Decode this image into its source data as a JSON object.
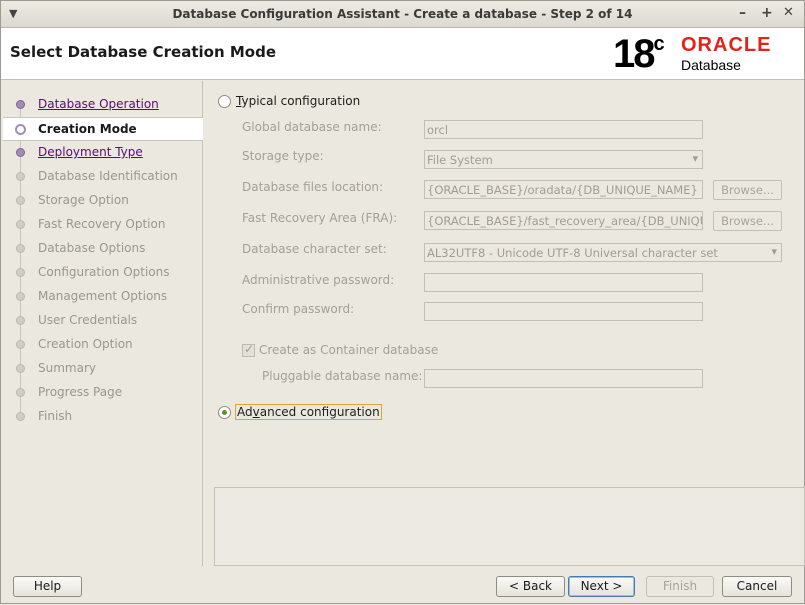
{
  "window": {
    "title": "Database Configuration Assistant - Create a database - Step 2 of 14",
    "controls": [
      "–",
      "+",
      "✕"
    ]
  },
  "header": {
    "page_title": "Select Database Creation Mode",
    "logo": {
      "version": "18",
      "version_sup": "c",
      "brand": "ORACLE",
      "product": "Database",
      "brand_color": "#e2231a"
    }
  },
  "sidebar": {
    "steps": [
      {
        "label": "Database Operation",
        "state": "done"
      },
      {
        "label": "Creation Mode",
        "state": "current"
      },
      {
        "label": "Deployment Type",
        "state": "done"
      },
      {
        "label": "Database Identification",
        "state": "pending"
      },
      {
        "label": "Storage Option",
        "state": "pending"
      },
      {
        "label": "Fast Recovery Option",
        "state": "pending"
      },
      {
        "label": "Database Options",
        "state": "pending"
      },
      {
        "label": "Configuration Options",
        "state": "pending"
      },
      {
        "label": "Management Options",
        "state": "pending"
      },
      {
        "label": "User Credentials",
        "state": "pending"
      },
      {
        "label": "Creation Option",
        "state": "pending"
      },
      {
        "label": "Summary",
        "state": "pending"
      },
      {
        "label": "Progress Page",
        "state": "pending"
      },
      {
        "label": "Finish",
        "state": "pending"
      }
    ]
  },
  "main": {
    "typical": {
      "label_mnemonic": "T",
      "label_rest": "ypical configuration",
      "selected": false,
      "global_db_name": {
        "label": "Global database name:",
        "value": "orcl"
      },
      "storage_type": {
        "label": "Storage type:",
        "value": "File System"
      },
      "db_files_location": {
        "label": "Database files location:",
        "value": "{ORACLE_BASE}/oradata/{DB_UNIQUE_NAME}",
        "browse": "Browse..."
      },
      "fra": {
        "label": "Fast Recovery Area (FRA):",
        "value": "{ORACLE_BASE}/fast_recovery_area/{DB_UNIQUE_NAME}",
        "browse": "Browse..."
      },
      "charset": {
        "label": "Database character set:",
        "value": "AL32UTF8 - Unicode UTF-8 Universal character set"
      },
      "admin_password": {
        "label": "Administrative password:",
        "value": ""
      },
      "confirm_password": {
        "label": "Confirm password:",
        "value": ""
      },
      "container_db": {
        "label": "Create as Container database",
        "checked": true
      },
      "pdb_name": {
        "label": "Pluggable database name:",
        "value": ""
      }
    },
    "advanced": {
      "label_pre": "Ad",
      "label_mnemonic": "v",
      "label_rest": "anced configuration",
      "selected": true
    }
  },
  "footer": {
    "help": "Help",
    "back": "< Back",
    "next": "Next >",
    "finish": "Finish",
    "cancel": "Cancel"
  }
}
